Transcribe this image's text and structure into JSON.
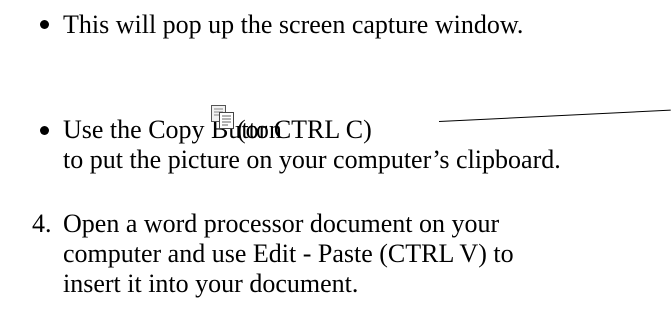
{
  "items": [
    {
      "marker": "bullet",
      "lines": [
        "This will pop up the screen capture window."
      ]
    },
    {
      "marker": "bullet",
      "line1_before_icon": "Use the Copy Button",
      "line1_after_icon": " (or CTRL C)",
      "line2": "to put the picture on your computer’s clipboard.",
      "icon": "copy-icon"
    },
    {
      "marker": "4.",
      "lines": [
        "Open a word processor document on your",
        "computer and use Edit - Paste (CTRL V) to",
        "insert it into your document."
      ]
    }
  ]
}
